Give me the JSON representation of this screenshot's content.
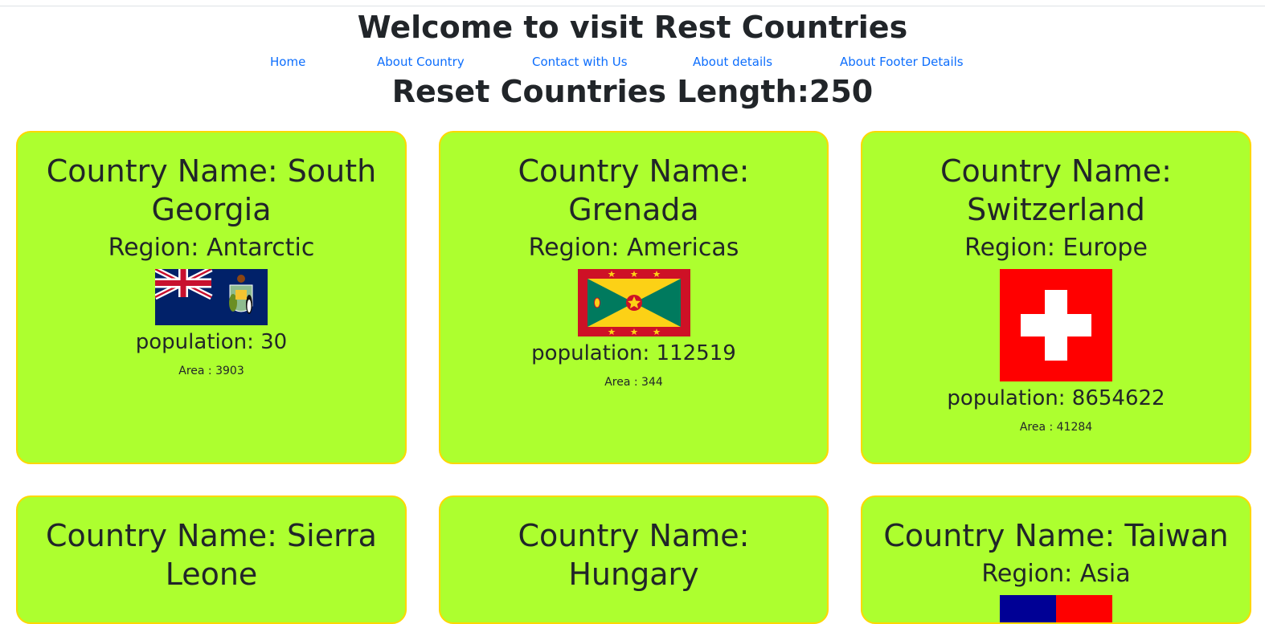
{
  "header": {
    "title": "Welcome to visit Rest Countries",
    "nav": [
      "Home",
      "About Country",
      "Contact with Us",
      "About details",
      "About Footer Details"
    ],
    "length_title": "Reset Countries Length:250"
  },
  "cards": [
    {
      "name": "Country Name: South Georgia",
      "region": "Region: Antarctic",
      "flag": "south-georgia-flag",
      "population": "population: 30",
      "area": "Area : 3903"
    },
    {
      "name": "Country Name: Grenada",
      "region": "Region: Americas",
      "flag": "grenada-flag",
      "population": "population: 112519",
      "area": "Area : 344"
    },
    {
      "name": "Country Name: Switzerland",
      "region": "Region: Europe",
      "flag": "switzerland-flag",
      "population": "population: 8654622",
      "area": "Area : 41284"
    },
    {
      "name": "Country Name: Sierra Leone",
      "region": "",
      "flag": "",
      "population": "",
      "area": ""
    },
    {
      "name": "Country Name: Hungary",
      "region": "",
      "flag": "",
      "population": "",
      "area": ""
    },
    {
      "name": "Country Name: Taiwan",
      "region": "Region: Asia",
      "flag": "taiwan-flag",
      "population": "",
      "area": ""
    }
  ],
  "colors": {
    "card_background": "#adff2f",
    "card_border": "#ffd700",
    "link": "#0d6efd",
    "text": "#212529"
  }
}
